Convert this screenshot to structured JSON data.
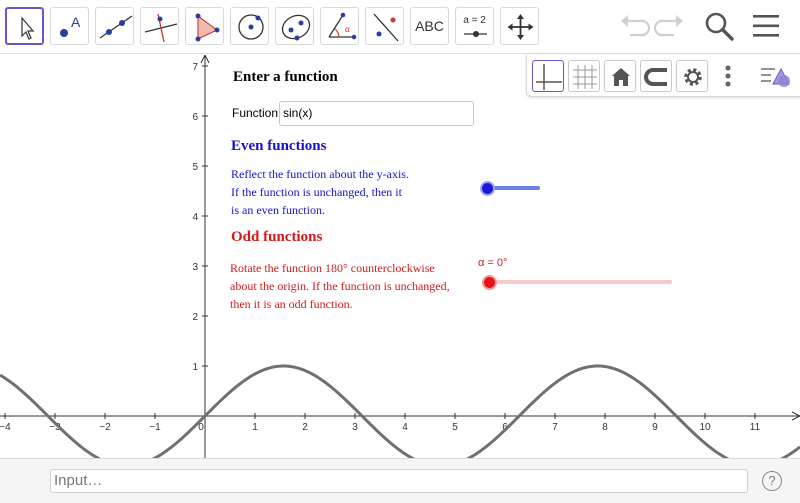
{
  "toolbar": {
    "tools": [
      {
        "name": "move-tool",
        "icon": "cursor-arrow-icon"
      },
      {
        "name": "point-tool",
        "icon": "point-a-icon"
      },
      {
        "name": "line-tool",
        "icon": "line-through-points-icon"
      },
      {
        "name": "perpendicular-line-tool",
        "icon": "perpendicular-line-icon"
      },
      {
        "name": "polygon-tool",
        "icon": "polygon-icon"
      },
      {
        "name": "circle-tool",
        "icon": "circle-center-point-icon"
      },
      {
        "name": "conic-tool",
        "icon": "ellipse-icon"
      },
      {
        "name": "angle-tool",
        "icon": "angle-icon"
      },
      {
        "name": "reflect-tool",
        "icon": "reflect-about-line-icon"
      },
      {
        "name": "text-tool",
        "label": "ABC"
      },
      {
        "name": "slider-tool",
        "label": "a = 2"
      },
      {
        "name": "move-graphics-view-tool",
        "icon": "move-arrows-icon"
      }
    ],
    "right": [
      "undo-icon",
      "redo-icon",
      "search-icon",
      "menu-icon"
    ]
  },
  "stylebar": {
    "buttons": [
      "axes-icon",
      "grid-icon",
      "home-icon",
      "point-capturing-icon",
      "gear-icon",
      "more-vertical-icon",
      "graphics-style-icon"
    ]
  },
  "graphics": {
    "title": "Enter a function",
    "function_label": "Function",
    "function_value": "sin(x)",
    "even": {
      "title": "Even functions",
      "lines": [
        "Reflect the function about the y-axis.",
        "If the function is unchanged, then it",
        "is an even function."
      ]
    },
    "odd": {
      "title": "Odd functions",
      "lines": [
        "Rotate the function 180° counterclockwise",
        "about the origin.  If the function is unchanged,",
        "then it is an odd function."
      ]
    },
    "alpha_label": "α = 0°",
    "colors": {
      "even": "#1515c8",
      "odd": "#d11a1a",
      "curve": "#707070",
      "accent": "#6557d2"
    },
    "x_ticks": [
      "−4",
      "−3",
      "−2",
      "−1",
      "0",
      "1",
      "2",
      "3",
      "4",
      "5",
      "6",
      "7",
      "8",
      "9",
      "10",
      "11"
    ],
    "y_ticks": [
      "1",
      "2",
      "3",
      "4",
      "5",
      "6",
      "7"
    ],
    "even_slider_value": 0,
    "alpha_slider_value": 0
  },
  "inputbar": {
    "placeholder": "Input…",
    "help": "?"
  }
}
